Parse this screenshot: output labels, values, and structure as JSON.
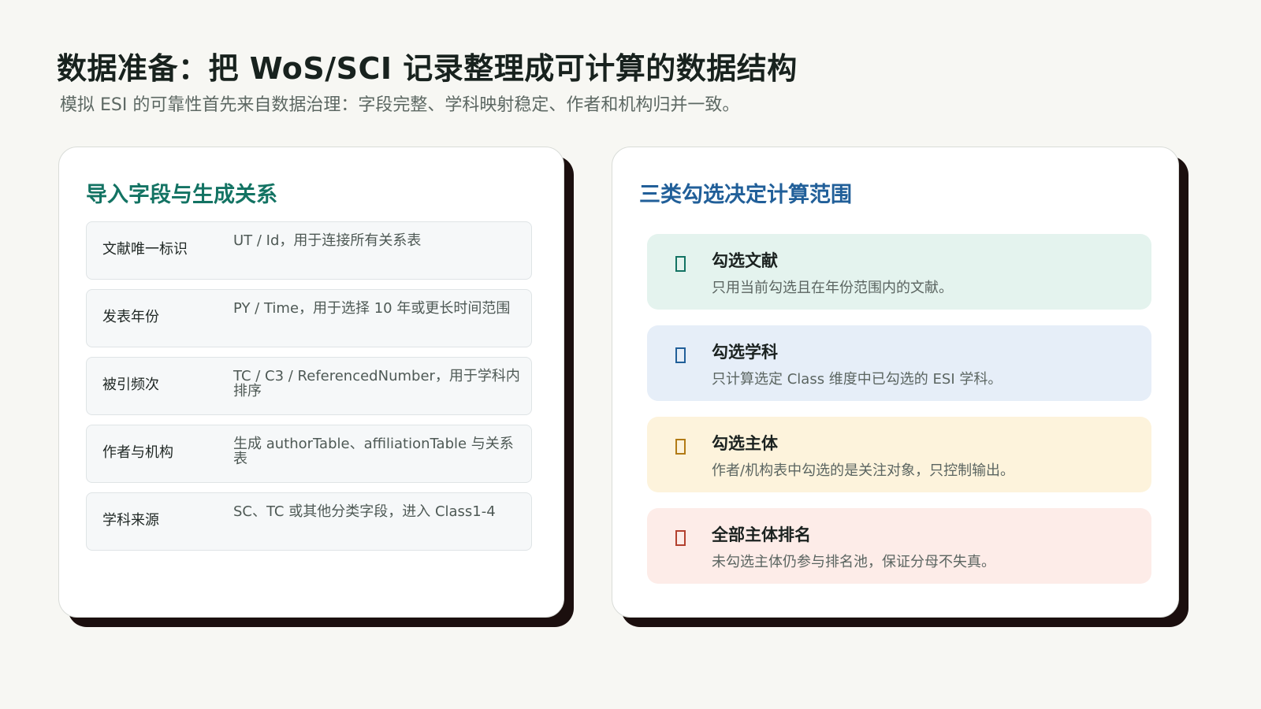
{
  "header": {
    "title": "数据准备：把 WoS/SCI 记录整理成可计算的数据结构",
    "subtitle": "模拟 ESI 的可靠性首先来自数据治理：字段完整、学科映射稳定、作者和机构归并一致。"
  },
  "left_card": {
    "title": "导入字段与生成关系",
    "fields": [
      {
        "name": "文献唯一标识",
        "desc": "UT / Id，用于连接所有关系表"
      },
      {
        "name": "发表年份",
        "desc": "PY / Time，用于选择 10 年或更长时间范围"
      },
      {
        "name": "被引频次",
        "desc": "TC / C3 / ReferencedNumber，用于学科内排序"
      },
      {
        "name": "作者与机构",
        "desc": "生成 authorTable、affiliationTable 与关系表"
      },
      {
        "name": "学科来源",
        "desc": "SC、TC 或其他分类字段，进入 Class1-4"
      }
    ]
  },
  "right_card": {
    "title": "三类勾选决定计算范围",
    "choices": [
      {
        "title": "勾选文献",
        "desc": "只用当前勾选且在年份范围内的文献。",
        "bg": "#e4f3ee",
        "icon_color": "#137363"
      },
      {
        "title": "勾选学科",
        "desc": "只计算选定 Class 维度中已勾选的 ESI 学科。",
        "bg": "#e6eef8",
        "icon_color": "#215f99"
      },
      {
        "title": "勾选主体",
        "desc": "作者/机构表中勾选的是关注对象，只控制输出。",
        "bg": "#fdf3dc",
        "icon_color": "#b27b16"
      },
      {
        "title": "全部主体排名",
        "desc": "未勾选主体仍参与排名池，保证分母不失真。",
        "bg": "#fdece8",
        "icon_color": "#b3412f"
      }
    ]
  }
}
